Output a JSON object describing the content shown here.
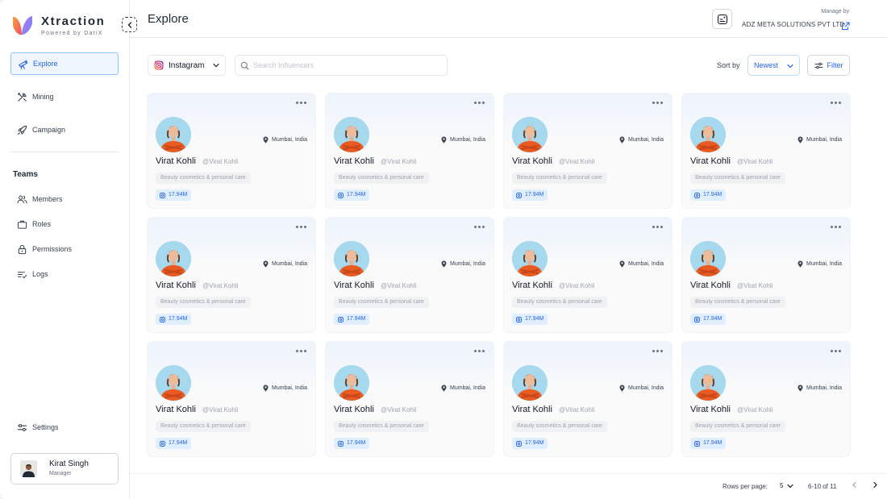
{
  "brand": {
    "name": "Xtraction",
    "subtitle": "Powered by DatiX"
  },
  "sidebar": {
    "primary": [
      {
        "label": "Explore",
        "icon": "telescope-icon",
        "active": true
      },
      {
        "label": "Mining",
        "icon": "tools-icon",
        "active": false
      },
      {
        "label": "Campaign",
        "icon": "rocket-icon",
        "active": false
      }
    ],
    "teams_title": "Teams",
    "teams": [
      {
        "label": "Members",
        "icon": "users-icon"
      },
      {
        "label": "Roles",
        "icon": "briefcase-icon"
      },
      {
        "label": "Permissions",
        "icon": "lock-icon"
      },
      {
        "label": "Logs",
        "icon": "list-check-icon"
      }
    ],
    "settings": {
      "label": "Settings",
      "icon": "sliders-icon"
    },
    "user": {
      "name": "Kirat Singh",
      "role": "Manager"
    }
  },
  "header": {
    "title": "Explore",
    "manage_by_label": "Manage by",
    "org_name": "ADZ META SOLUTIONS PVT LTD"
  },
  "toolbar": {
    "platform": "Instagram",
    "search_placeholder": "Search Influencers",
    "sort_label": "Sort by",
    "sort_value": "Newest",
    "filter_label": "Filter"
  },
  "cards": [
    {
      "name": "Virat Kohli",
      "handle": "@Virat Kohli",
      "location": "Mumbai, India",
      "category": "Beauty cosmetics & personal care",
      "followers": "17.94M"
    },
    {
      "name": "Virat Kohli",
      "handle": "@Virat Kohli",
      "location": "Mumbai, India",
      "category": "Beauty cosmetics & personal care",
      "followers": "17.94M"
    },
    {
      "name": "Virat Kohli",
      "handle": "@Virat Kohli",
      "location": "Mumbai, India",
      "category": "Beauty cosmetics & personal care",
      "followers": "17.94M"
    },
    {
      "name": "Virat Kohli",
      "handle": "@Virat Kohli",
      "location": "Mumbai, India",
      "category": "Beauty cosmetics & personal care",
      "followers": "17.94M"
    },
    {
      "name": "Virat Kohli",
      "handle": "@Virat Kohli",
      "location": "Mumbai, India",
      "category": "Beauty cosmetics & personal care",
      "followers": "17.94M"
    },
    {
      "name": "Virat Kohli",
      "handle": "@Virat Kohli",
      "location": "Mumbai, India",
      "category": "Beauty cosmetics & personal care",
      "followers": "17.94M"
    },
    {
      "name": "Virat Kohli",
      "handle": "@Virat Kohli",
      "location": "Mumbai, India",
      "category": "Beauty cosmetics & personal care",
      "followers": "17.94M"
    },
    {
      "name": "Virat Kohli",
      "handle": "@Virat Kohli",
      "location": "Mumbai, India",
      "category": "Beauty cosmetics & personal care",
      "followers": "17.94M"
    },
    {
      "name": "Virat Kohli",
      "handle": "@Virat Kohli",
      "location": "Mumbai, India",
      "category": "Beauty cosmetics & personal care",
      "followers": "17.94M"
    },
    {
      "name": "Virat Kohli",
      "handle": "@Virat Kohli",
      "location": "Mumbai, India",
      "category": "Beauty cosmetics & personal care",
      "followers": "17.94M"
    },
    {
      "name": "Virat Kohli",
      "handle": "@Virat Kohli",
      "location": "Mumbai, India",
      "category": "Beauty cosmetics & personal care",
      "followers": "17.94M"
    },
    {
      "name": "Virat Kohli",
      "handle": "@Virat Kohli",
      "location": "Mumbai, India",
      "category": "Beauty cosmetics & personal care",
      "followers": "17.94M"
    }
  ],
  "pagination": {
    "rows_label": "Rows per page:",
    "rows_value": "5",
    "range": "6-10 of 11"
  },
  "colors": {
    "accent": "#2563eb",
    "active_bg": "#eff6ff",
    "followers_bg": "#e0efff",
    "avatar_bg": "#9fd3ea",
    "shirt": "#ea5b22"
  }
}
